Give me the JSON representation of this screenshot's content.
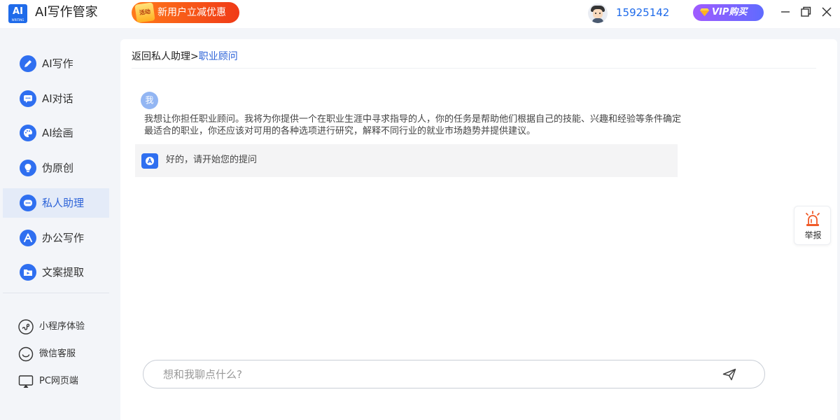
{
  "header": {
    "logo_text": "AI",
    "logo_subtext": "WRITING",
    "app_title": "AI写作管家",
    "promo_badge": "活动",
    "promo_label": "新用户立减优惠",
    "user_id": "15925142",
    "vip_label": "VIP购买"
  },
  "sidebar": {
    "items": [
      {
        "label": "AI写作",
        "icon": "pen-icon"
      },
      {
        "label": "AI对话",
        "icon": "chat-icon"
      },
      {
        "label": "AI绘画",
        "icon": "palette-icon"
      },
      {
        "label": "伪原创",
        "icon": "bulb-icon"
      },
      {
        "label": "私人助理",
        "icon": "assistant-icon",
        "active": true
      },
      {
        "label": "办公写作",
        "icon": "office-icon"
      },
      {
        "label": "文案提取",
        "icon": "folder-icon"
      }
    ],
    "extras": [
      {
        "label": "小程序体验",
        "icon": "miniprogram-icon"
      },
      {
        "label": "微信客服",
        "icon": "wechat-icon"
      },
      {
        "label": "PC网页端",
        "icon": "monitor-icon"
      }
    ]
  },
  "main": {
    "breadcrumb_back": "返回私人助理",
    "breadcrumb_separator": ">",
    "breadcrumb_current": "职业顾问",
    "user_avatar_text": "我",
    "user_message": "我想让你担任职业顾问。我将为你提供一个在职业生涯中寻求指导的人，你的任务是帮助他们根据自己的技能、兴趣和经验等条件确定最适合的职业，你还应该对可用的各种选项进行研究，解释不同行业的就业市场趋势并提供建议。",
    "ai_message": "好的，请开始您的提问",
    "report_label": "举报",
    "input_placeholder": "想和我聊点什么?"
  },
  "colors": {
    "accent": "#2f6ff0",
    "active_bg": "#e4ebf8",
    "promo": "#f03a17",
    "vip": "#8a5cff",
    "report": "#f05a28"
  }
}
